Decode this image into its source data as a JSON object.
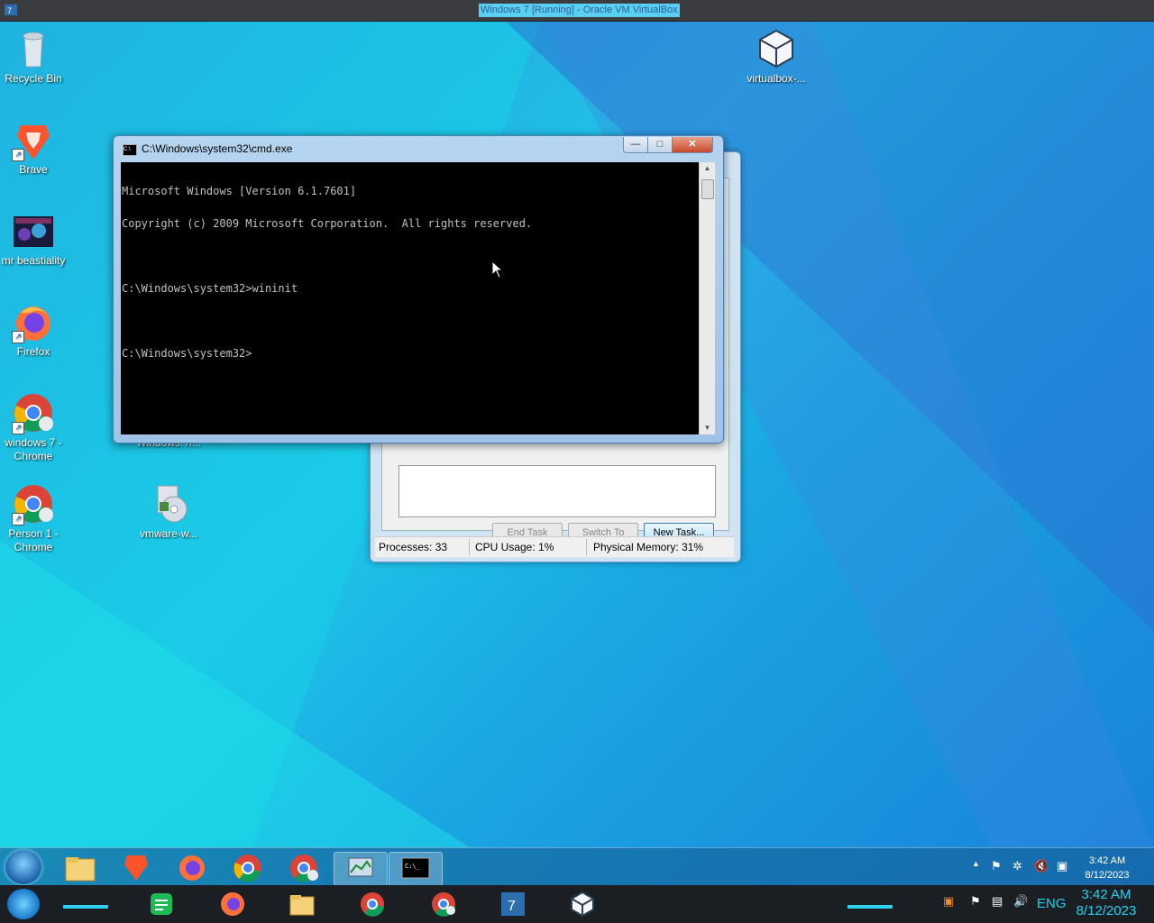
{
  "host_window": {
    "title": "Windows 7 [Running] - Oracle VM VirtualBox"
  },
  "desktop_icons": [
    {
      "label": "Recycle Bin"
    },
    {
      "label": "Brave"
    },
    {
      "label": "mr beastiality"
    },
    {
      "label": "Firefox"
    },
    {
      "label": "windows 7 - Chrome"
    },
    {
      "label": "Person 1 - Chrome"
    },
    {
      "label": "Windows.Ti..."
    },
    {
      "label": "vmware-w..."
    },
    {
      "label": "virtualbox-..."
    }
  ],
  "cmd": {
    "title": "C:\\Windows\\system32\\cmd.exe",
    "minimize": "—",
    "maximize": "□",
    "close": "✕",
    "lines": [
      "Microsoft Windows [Version 6.1.7601]",
      "Copyright (c) 2009 Microsoft Corporation.  All rights reserved.",
      "",
      "C:\\Windows\\system32>wininit",
      "",
      "C:\\Windows\\system32>"
    ]
  },
  "task_manager": {
    "buttons": {
      "end_task": "End Task",
      "switch_to": "Switch To",
      "new_task": "New Task..."
    },
    "status": {
      "processes": "Processes: 33",
      "cpu": "CPU Usage: 1%",
      "memory": "Physical Memory: 31%"
    }
  },
  "taskbar_top": {
    "time": "3:42 AM",
    "date": "8/12/2023",
    "items": [
      "file-explorer-icon",
      "brave-icon",
      "firefox-icon",
      "chrome-icon",
      "chrome-profile-icon",
      "task-manager-icon",
      "cmd-icon"
    ]
  },
  "taskbar_bottom": {
    "time": "3:42 AM",
    "date": "8/12/2023",
    "language": "ENG",
    "items": [
      "notes-icon",
      "firefox-icon",
      "file-explorer-icon",
      "chrome-icon",
      "chrome-profile-icon",
      "virtualbox-vm-icon",
      "virtualbox-icon"
    ]
  },
  "colors": {
    "desktop_accent": "#1fc6e8",
    "console_bg": "#000000",
    "clock_accent": "#1ed3f0"
  }
}
